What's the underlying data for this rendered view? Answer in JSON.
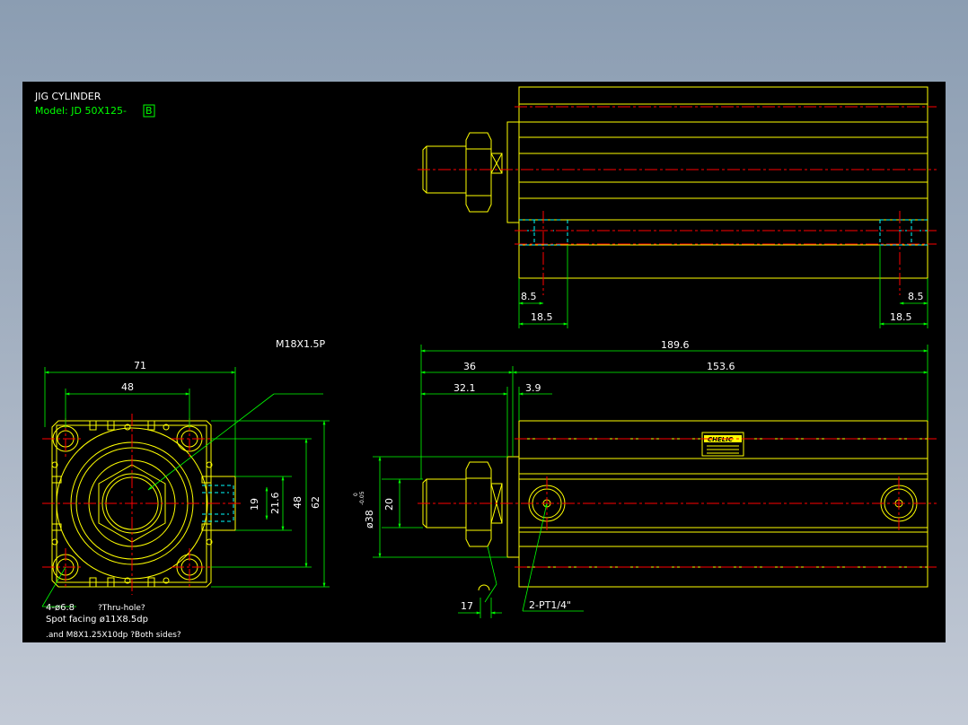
{
  "title": {
    "line1": "JIG CYLINDER",
    "model_prefix": "Model: JD 50X125-",
    "model_suffix": "B"
  },
  "front_view": {
    "dims": {
      "d71": "71",
      "d48h": "48",
      "d19": "19",
      "d216": "21.6",
      "d48v": "48",
      "d62": "62"
    },
    "thread_callout": "M18X1.5P",
    "hole_note1": "4-ø6.8",
    "hole_note2": "?Thru-hole?",
    "hole_note3": "Spot facing ø11X8.5dp",
    "hole_note4": ".and M8X1.25X10dp ?Both sides?"
  },
  "top_view": {
    "dims": {
      "d85l": "8.5",
      "d185l": "18.5",
      "d85r": "8.5",
      "d185r": "18.5"
    }
  },
  "side_view": {
    "dims": {
      "d1896": "189.6",
      "d36": "36",
      "d1536": "153.6",
      "d321": "32.1",
      "d39": "3.9",
      "d20": "20",
      "d38": "ø38",
      "d38_tol": "-0.05",
      "d38_tol2": "0",
      "d17": "17"
    },
    "port_note": "2-PT1/4\"",
    "brand_label": "CHELIC"
  },
  "colors": {
    "outline": "#ffff00",
    "dimension": "#00ff00",
    "centerline": "#ff0000",
    "hidden": "#00ffff",
    "text": "#ffffff",
    "background": "#000000"
  }
}
